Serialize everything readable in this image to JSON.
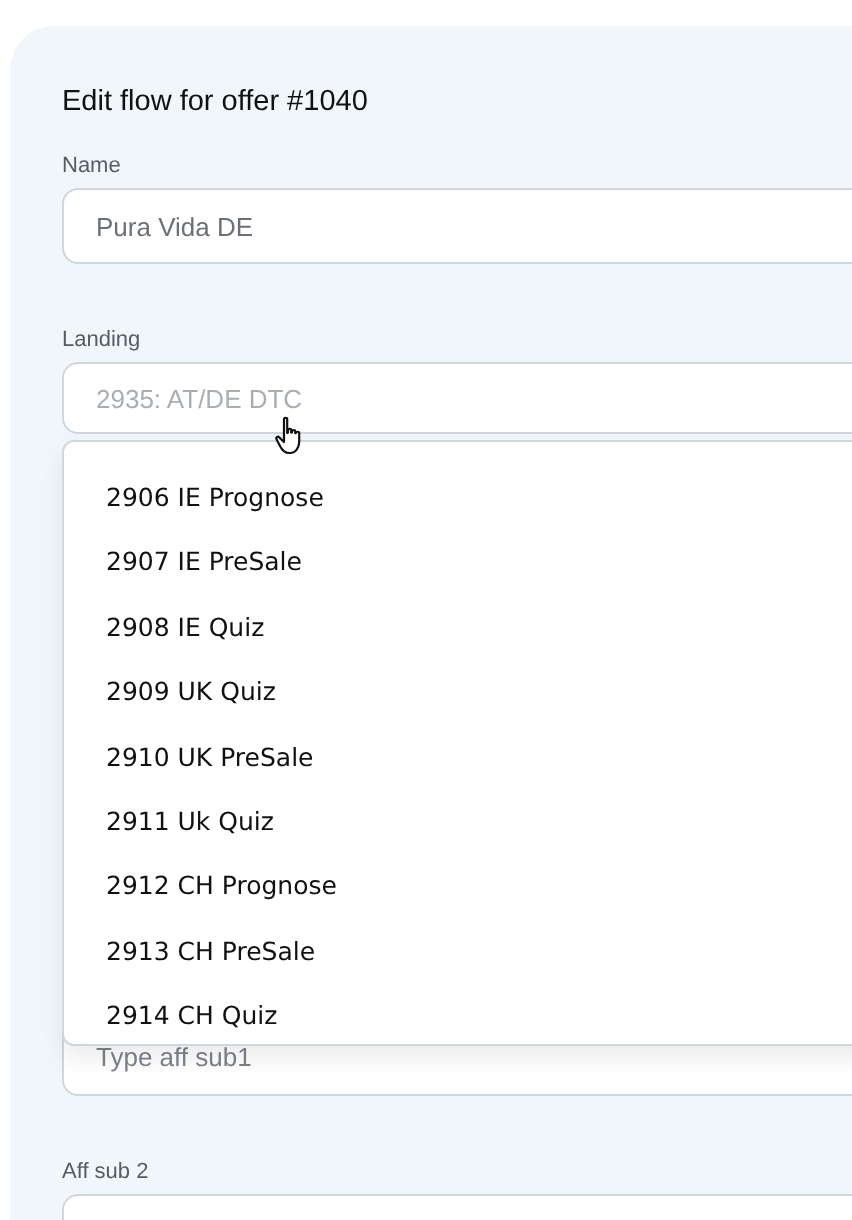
{
  "title": "Edit flow for offer #1040",
  "fields": [
    {
      "kind": "input",
      "label": "Name",
      "value": "Pura Vida DE"
    },
    {
      "kind": "select",
      "label": "Landing",
      "placeholder": "2935: AT/DE DTC",
      "options": [
        "2906 IE Prognose",
        "2907 IE PreSale",
        "2908 IE Quiz",
        "2909 UK Quiz",
        "2910 UK PreSale",
        "2911 Uk Quiz",
        "2912 CH Prognose",
        "2913 CH PreSale",
        "2914 CH Quiz"
      ]
    },
    {
      "kind": "input",
      "placeholder": "Type aff sub1"
    },
    {
      "kind": "input",
      "label": "Aff sub 2"
    }
  ]
}
